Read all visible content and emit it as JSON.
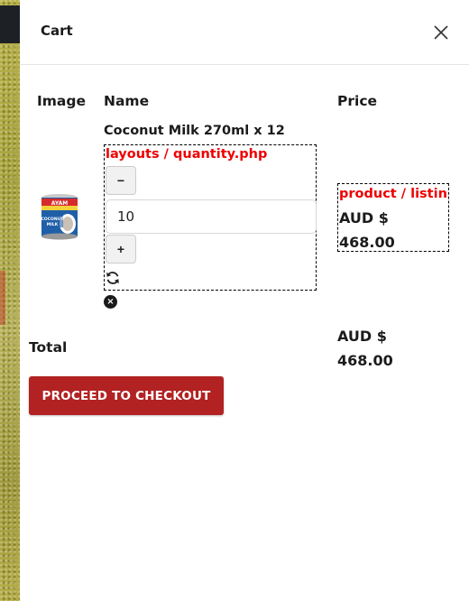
{
  "colors": {
    "accent": "#b22222",
    "debug_text": "#ee0000"
  },
  "cart": {
    "title": "Cart",
    "close_icon": "close-icon"
  },
  "table": {
    "headers": {
      "image": "Image",
      "name": "Name",
      "price": "Price"
    }
  },
  "item": {
    "name": "Coconut Milk 270ml x 12",
    "quantity_template_label": "layouts / quantity.php",
    "minus_label": "−",
    "plus_label": "+",
    "quantity_value": "10",
    "refresh_icon": "refresh-icon",
    "remove_icon": "remove-icon",
    "remove_label": "×",
    "price_template_label": "product / listin",
    "price": "AUD $ 468.00",
    "image_text": {
      "brand": "AYAM",
      "line1": "COCONUT",
      "line2": "MILK"
    }
  },
  "total": {
    "label": "Total",
    "value": "AUD $ 468.00"
  },
  "checkout": {
    "label": "PROCEED TO CHECKOUT"
  }
}
